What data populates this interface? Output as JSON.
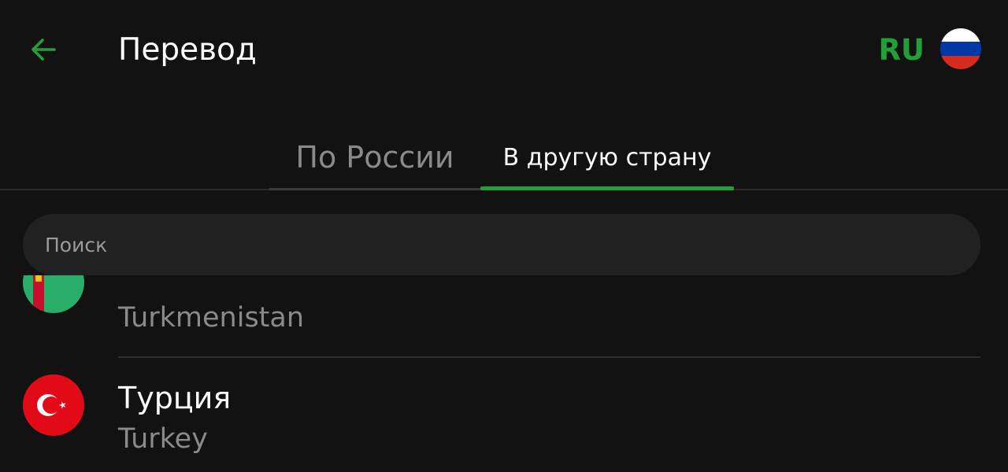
{
  "header": {
    "title": "Перевод",
    "back_icon": "arrow-left-icon",
    "language_code": "RU",
    "language_flag": "russia-flag-icon"
  },
  "tabs": [
    {
      "label": "По России",
      "active": false
    },
    {
      "label": "В другую страну",
      "active": true
    }
  ],
  "search": {
    "placeholder": "Поиск",
    "value": ""
  },
  "countries": [
    {
      "name": "",
      "name_en": "Turkmenistan",
      "flag": "turkmenistan-flag-icon"
    },
    {
      "name": "Турция",
      "name_en": "Turkey",
      "flag": "turkey-flag-icon"
    }
  ],
  "colors": {
    "background": "#121212",
    "accent": "#21a038",
    "search_bg": "#212121",
    "secondary_text": "#8a8a8a",
    "russia_flag": [
      "#ffffff",
      "#0039a6",
      "#d52b1e"
    ],
    "turkey_flag": "#e30a17",
    "turkmenistan_flag": "#28ae66"
  }
}
